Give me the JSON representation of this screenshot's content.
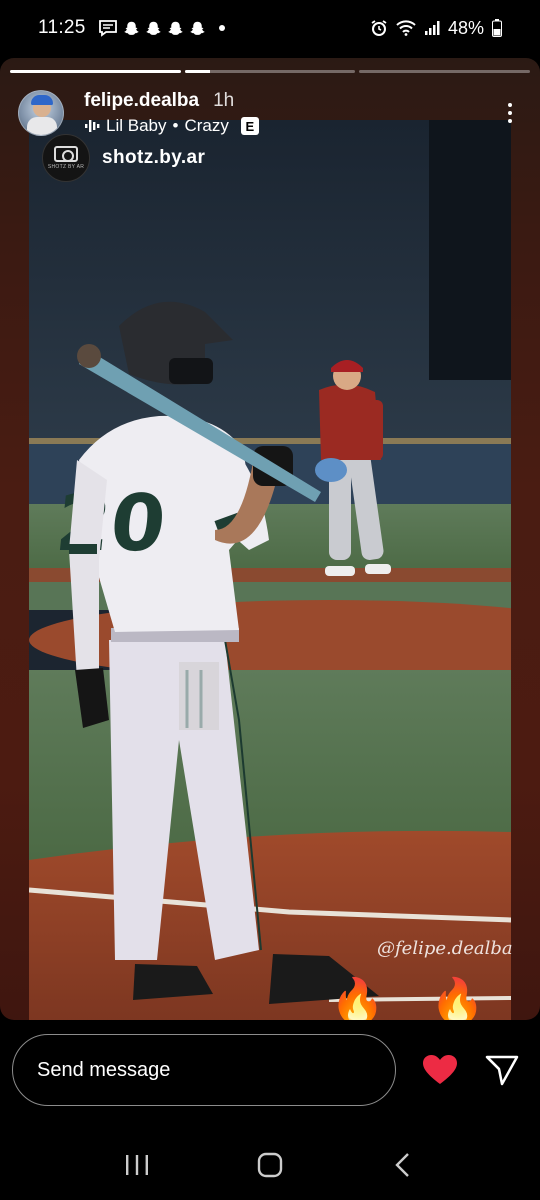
{
  "status_bar": {
    "time": "11:25",
    "battery": "48%",
    "icons_left": [
      "message-icon",
      "snapchat-ghost-icon",
      "snapchat-ghost-icon",
      "snapchat-ghost-icon",
      "snapchat-ghost-icon",
      "dot-icon"
    ],
    "icons_right": [
      "alarm-icon",
      "wifi-icon",
      "signal-icon",
      "battery-icon"
    ]
  },
  "story": {
    "progress_segments": [
      1.0,
      0.15,
      0.0
    ],
    "username": "felipe.dealba",
    "time_ago": "1h",
    "music": {
      "artist": "Lil Baby",
      "separator": "•",
      "song": "Crazy",
      "explicit_badge": "E"
    },
    "watermark": {
      "account": "shotz.by.ar",
      "logo_text": "SHOTZ BY AR"
    },
    "photo_handle": "@felipe.dealba",
    "stickers": [
      "🔥",
      "🔥"
    ]
  },
  "reply_bar": {
    "placeholder": "Send message"
  },
  "colors": {
    "like_heart": "#ed2b44",
    "story_bg": "#4a1c12"
  }
}
